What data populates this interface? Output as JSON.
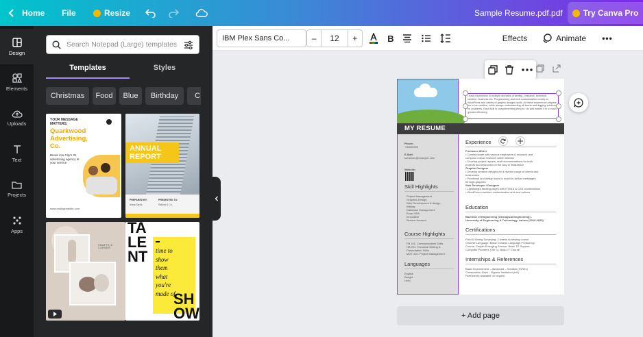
{
  "topbar": {
    "home_label": "Home",
    "file_label": "File",
    "resize_label": "Resize",
    "doc_title": "Sample Resume.pdf.pdf",
    "pro_label": "Try Canva Pro"
  },
  "rail": {
    "items": [
      {
        "label": "Design"
      },
      {
        "label": "Elements"
      },
      {
        "label": "Uploads"
      },
      {
        "label": "Text"
      },
      {
        "label": "Projects"
      },
      {
        "label": "Apps"
      }
    ]
  },
  "panel": {
    "search_placeholder": "Search Notepad (Large) templates",
    "tabs": [
      "Templates",
      "Styles"
    ],
    "chips": [
      "Christmas",
      "Food",
      "Blue",
      "Birthday",
      "C"
    ],
    "templates": [
      {
        "headline": "YOUR MESSAGE MATTERS.",
        "title": "Quarkwood Advertising, Co.",
        "body": "Break into City's #1 advertising agency at your service",
        "footer_left": "www.reallygreatsite.com"
      },
      {
        "title": "ANNUAL REPORT",
        "meta_left": "PREPARED BY:",
        "meta_left_name": "Avery Davis",
        "meta_right": "PRESENTED TO:",
        "meta_right_name": "Salford & Co."
      },
      {
        "brand": "CRAFTS & CORNER"
      },
      {
        "word_top": "TALENT",
        "lines": [
          "time to",
          "show",
          "them",
          "what",
          "you're",
          "made of"
        ],
        "word_bottom": "SHOW"
      }
    ]
  },
  "toolbar": {
    "font": "IBM Plex Sans Co...",
    "minus": "–",
    "size": "12",
    "plus": "+",
    "bold": "B",
    "effects_label": "Effects",
    "animate_label": "Animate",
    "more": "•••"
  },
  "resume": {
    "title": "MY RESUME",
    "phone_label": "Phone:",
    "phone": "+00000000",
    "email_label": "E-Mail:",
    "email": "someone@example.com",
    "website_label": "Website:",
    "skills_title": "Skill Highlights",
    "skills": [
      "Project Management",
      "Graphics Design",
      "Web Development & design",
      "Writing",
      "Database Management",
      "Excel VBA",
      "Innovative",
      "Service-focused"
    ],
    "course_title": "Course Highlights",
    "courses": [
      "FB 101: Communication Skills",
      "HB 201: Technical Writing & Presentation Skills",
      "MGT 410: Project Management"
    ],
    "lang_title": "Languages",
    "langs": [
      "English",
      "Bangla",
      "Urdu"
    ],
    "about": "I have experience in multiple domains of writing - research, technical, creative, business etc. Programming and web customization mostly on WordPress and variety of graphic designs skills. All these experience prepare me to be creative, while always understanding all facets and digging solutions for problems. Each skill is complementing the job I do and makes it in a much greater efficiency.",
    "exp_title": "Experience",
    "exp_lines": [
      "Freelance Writer",
      "• Communicate with various employees & research and",
      "compose robust research within timeline",
      "• Develop project reports, draft documentations for both",
      "projects and instruction of the way to finalization",
      "Graphic Designer",
      "• Develop creative designs for a diverse range of clients and",
      "businesses",
      "• Proofread and design tools to reach to deliver messages",
      "through graphics",
      "Web Developer / Designer",
      "• Lightweight landing pages with HTML5 & CSS combinations",
      "• WordPress machine customization and new options"
    ],
    "edu_title": "Education",
    "edu_lines": [
      "Bachelor of Engineering (Geological Engineering) -",
      "University of Engineering & Technology, Lahore (2016-2020)"
    ],
    "cert_title": "Certifications",
    "cert_lines": [
      "Field & Mining Surveying: 2 weeks surveying course",
      "Chinese Language: Basic Chinese Language Proficiency",
      "Course, Punjab Emerging Service: Basic TE Support,",
      "Computer Pioneers (Tier 1): Basic IT Course"
    ],
    "intern_title": "Internships & References",
    "intern_lines": [
      "Basic Improvement – Advanced – Solution (IT/Rev)",
      "Construction Nave – Bypass Institution (Intl)",
      "References available on request"
    ]
  },
  "canvas": {
    "add_page_label": "+ Add page"
  },
  "colors": {
    "accent": "#8b3dff",
    "rail_bg": "#18191b",
    "panel_bg": "#252627"
  }
}
